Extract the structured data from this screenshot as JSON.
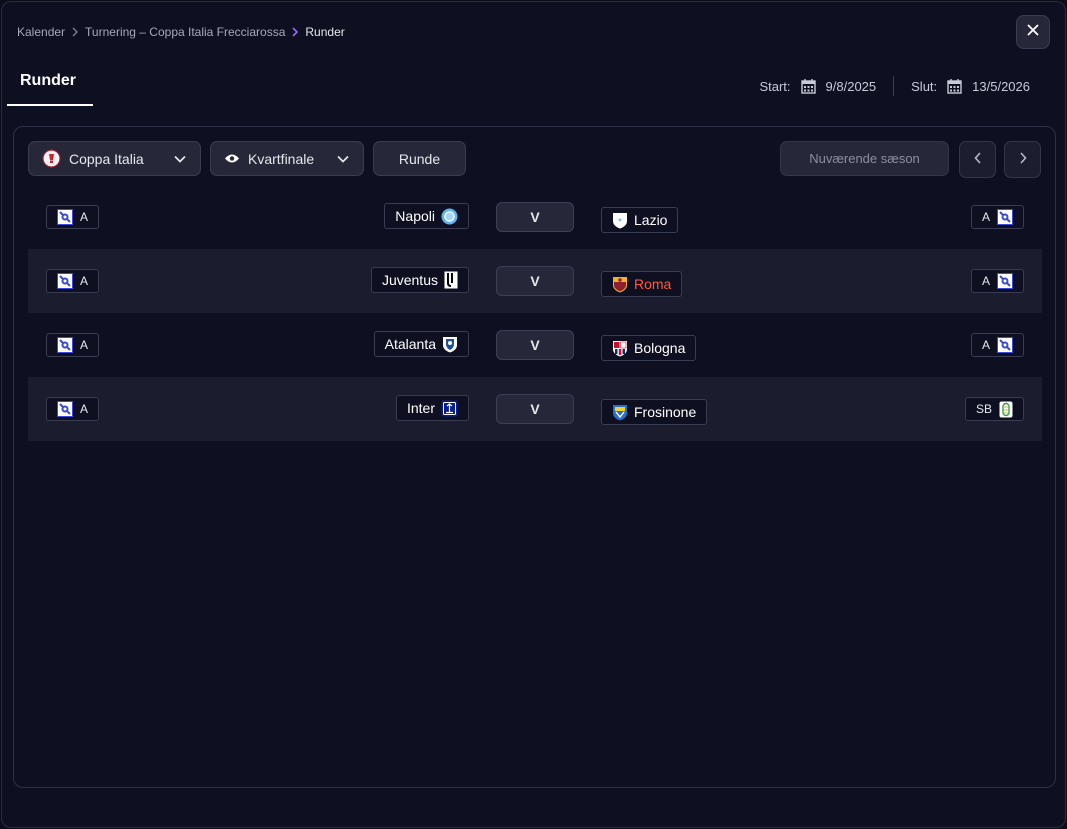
{
  "breadcrumb": {
    "items": [
      "Kalender",
      "Turnering – Coppa Italia Frecciarossa",
      "Runder"
    ]
  },
  "tab": {
    "label": "Runder"
  },
  "dates": {
    "start_label": "Start:",
    "start_value": "9/8/2025",
    "end_label": "Slut:",
    "end_value": "13/5/2026"
  },
  "toolbar": {
    "competition": "Coppa Italia",
    "stage": "Kvartfinale",
    "round_button": "Runde",
    "season_button": "Nuværende sæson"
  },
  "matches": [
    {
      "home_league": "A",
      "home": "Napoli",
      "vs": "V",
      "away": "Lazio",
      "away_league": "A",
      "away_highlight": false
    },
    {
      "home_league": "A",
      "home": "Juventus",
      "vs": "V",
      "away": "Roma",
      "away_league": "A",
      "away_highlight": true
    },
    {
      "home_league": "A",
      "home": "Atalanta",
      "vs": "V",
      "away": "Bologna",
      "away_league": "A",
      "away_highlight": false
    },
    {
      "home_league": "A",
      "home": "Inter",
      "vs": "V",
      "away": "Frosinone",
      "away_league": "SB",
      "away_highlight": false
    }
  ],
  "colors": {
    "background": "#0e1022",
    "row_alt": "#1b1d2e",
    "button": "#26283a",
    "highlight": "#ff5a3c",
    "breadcrumb_chevron_active": "#8f6bff"
  }
}
